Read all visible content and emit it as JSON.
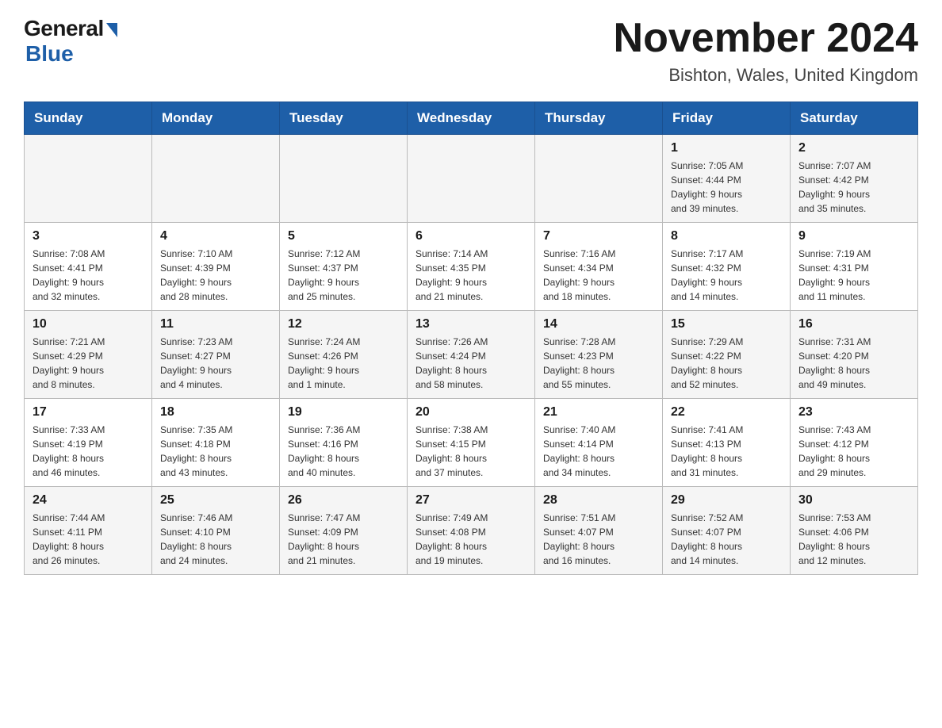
{
  "logo": {
    "general": "General",
    "blue": "Blue"
  },
  "title": "November 2024",
  "location": "Bishton, Wales, United Kingdom",
  "days_of_week": [
    "Sunday",
    "Monday",
    "Tuesday",
    "Wednesday",
    "Thursday",
    "Friday",
    "Saturday"
  ],
  "weeks": [
    [
      {
        "day": "",
        "info": ""
      },
      {
        "day": "",
        "info": ""
      },
      {
        "day": "",
        "info": ""
      },
      {
        "day": "",
        "info": ""
      },
      {
        "day": "",
        "info": ""
      },
      {
        "day": "1",
        "info": "Sunrise: 7:05 AM\nSunset: 4:44 PM\nDaylight: 9 hours\nand 39 minutes."
      },
      {
        "day": "2",
        "info": "Sunrise: 7:07 AM\nSunset: 4:42 PM\nDaylight: 9 hours\nand 35 minutes."
      }
    ],
    [
      {
        "day": "3",
        "info": "Sunrise: 7:08 AM\nSunset: 4:41 PM\nDaylight: 9 hours\nand 32 minutes."
      },
      {
        "day": "4",
        "info": "Sunrise: 7:10 AM\nSunset: 4:39 PM\nDaylight: 9 hours\nand 28 minutes."
      },
      {
        "day": "5",
        "info": "Sunrise: 7:12 AM\nSunset: 4:37 PM\nDaylight: 9 hours\nand 25 minutes."
      },
      {
        "day": "6",
        "info": "Sunrise: 7:14 AM\nSunset: 4:35 PM\nDaylight: 9 hours\nand 21 minutes."
      },
      {
        "day": "7",
        "info": "Sunrise: 7:16 AM\nSunset: 4:34 PM\nDaylight: 9 hours\nand 18 minutes."
      },
      {
        "day": "8",
        "info": "Sunrise: 7:17 AM\nSunset: 4:32 PM\nDaylight: 9 hours\nand 14 minutes."
      },
      {
        "day": "9",
        "info": "Sunrise: 7:19 AM\nSunset: 4:31 PM\nDaylight: 9 hours\nand 11 minutes."
      }
    ],
    [
      {
        "day": "10",
        "info": "Sunrise: 7:21 AM\nSunset: 4:29 PM\nDaylight: 9 hours\nand 8 minutes."
      },
      {
        "day": "11",
        "info": "Sunrise: 7:23 AM\nSunset: 4:27 PM\nDaylight: 9 hours\nand 4 minutes."
      },
      {
        "day": "12",
        "info": "Sunrise: 7:24 AM\nSunset: 4:26 PM\nDaylight: 9 hours\nand 1 minute."
      },
      {
        "day": "13",
        "info": "Sunrise: 7:26 AM\nSunset: 4:24 PM\nDaylight: 8 hours\nand 58 minutes."
      },
      {
        "day": "14",
        "info": "Sunrise: 7:28 AM\nSunset: 4:23 PM\nDaylight: 8 hours\nand 55 minutes."
      },
      {
        "day": "15",
        "info": "Sunrise: 7:29 AM\nSunset: 4:22 PM\nDaylight: 8 hours\nand 52 minutes."
      },
      {
        "day": "16",
        "info": "Sunrise: 7:31 AM\nSunset: 4:20 PM\nDaylight: 8 hours\nand 49 minutes."
      }
    ],
    [
      {
        "day": "17",
        "info": "Sunrise: 7:33 AM\nSunset: 4:19 PM\nDaylight: 8 hours\nand 46 minutes."
      },
      {
        "day": "18",
        "info": "Sunrise: 7:35 AM\nSunset: 4:18 PM\nDaylight: 8 hours\nand 43 minutes."
      },
      {
        "day": "19",
        "info": "Sunrise: 7:36 AM\nSunset: 4:16 PM\nDaylight: 8 hours\nand 40 minutes."
      },
      {
        "day": "20",
        "info": "Sunrise: 7:38 AM\nSunset: 4:15 PM\nDaylight: 8 hours\nand 37 minutes."
      },
      {
        "day": "21",
        "info": "Sunrise: 7:40 AM\nSunset: 4:14 PM\nDaylight: 8 hours\nand 34 minutes."
      },
      {
        "day": "22",
        "info": "Sunrise: 7:41 AM\nSunset: 4:13 PM\nDaylight: 8 hours\nand 31 minutes."
      },
      {
        "day": "23",
        "info": "Sunrise: 7:43 AM\nSunset: 4:12 PM\nDaylight: 8 hours\nand 29 minutes."
      }
    ],
    [
      {
        "day": "24",
        "info": "Sunrise: 7:44 AM\nSunset: 4:11 PM\nDaylight: 8 hours\nand 26 minutes."
      },
      {
        "day": "25",
        "info": "Sunrise: 7:46 AM\nSunset: 4:10 PM\nDaylight: 8 hours\nand 24 minutes."
      },
      {
        "day": "26",
        "info": "Sunrise: 7:47 AM\nSunset: 4:09 PM\nDaylight: 8 hours\nand 21 minutes."
      },
      {
        "day": "27",
        "info": "Sunrise: 7:49 AM\nSunset: 4:08 PM\nDaylight: 8 hours\nand 19 minutes."
      },
      {
        "day": "28",
        "info": "Sunrise: 7:51 AM\nSunset: 4:07 PM\nDaylight: 8 hours\nand 16 minutes."
      },
      {
        "day": "29",
        "info": "Sunrise: 7:52 AM\nSunset: 4:07 PM\nDaylight: 8 hours\nand 14 minutes."
      },
      {
        "day": "30",
        "info": "Sunrise: 7:53 AM\nSunset: 4:06 PM\nDaylight: 8 hours\nand 12 minutes."
      }
    ]
  ]
}
